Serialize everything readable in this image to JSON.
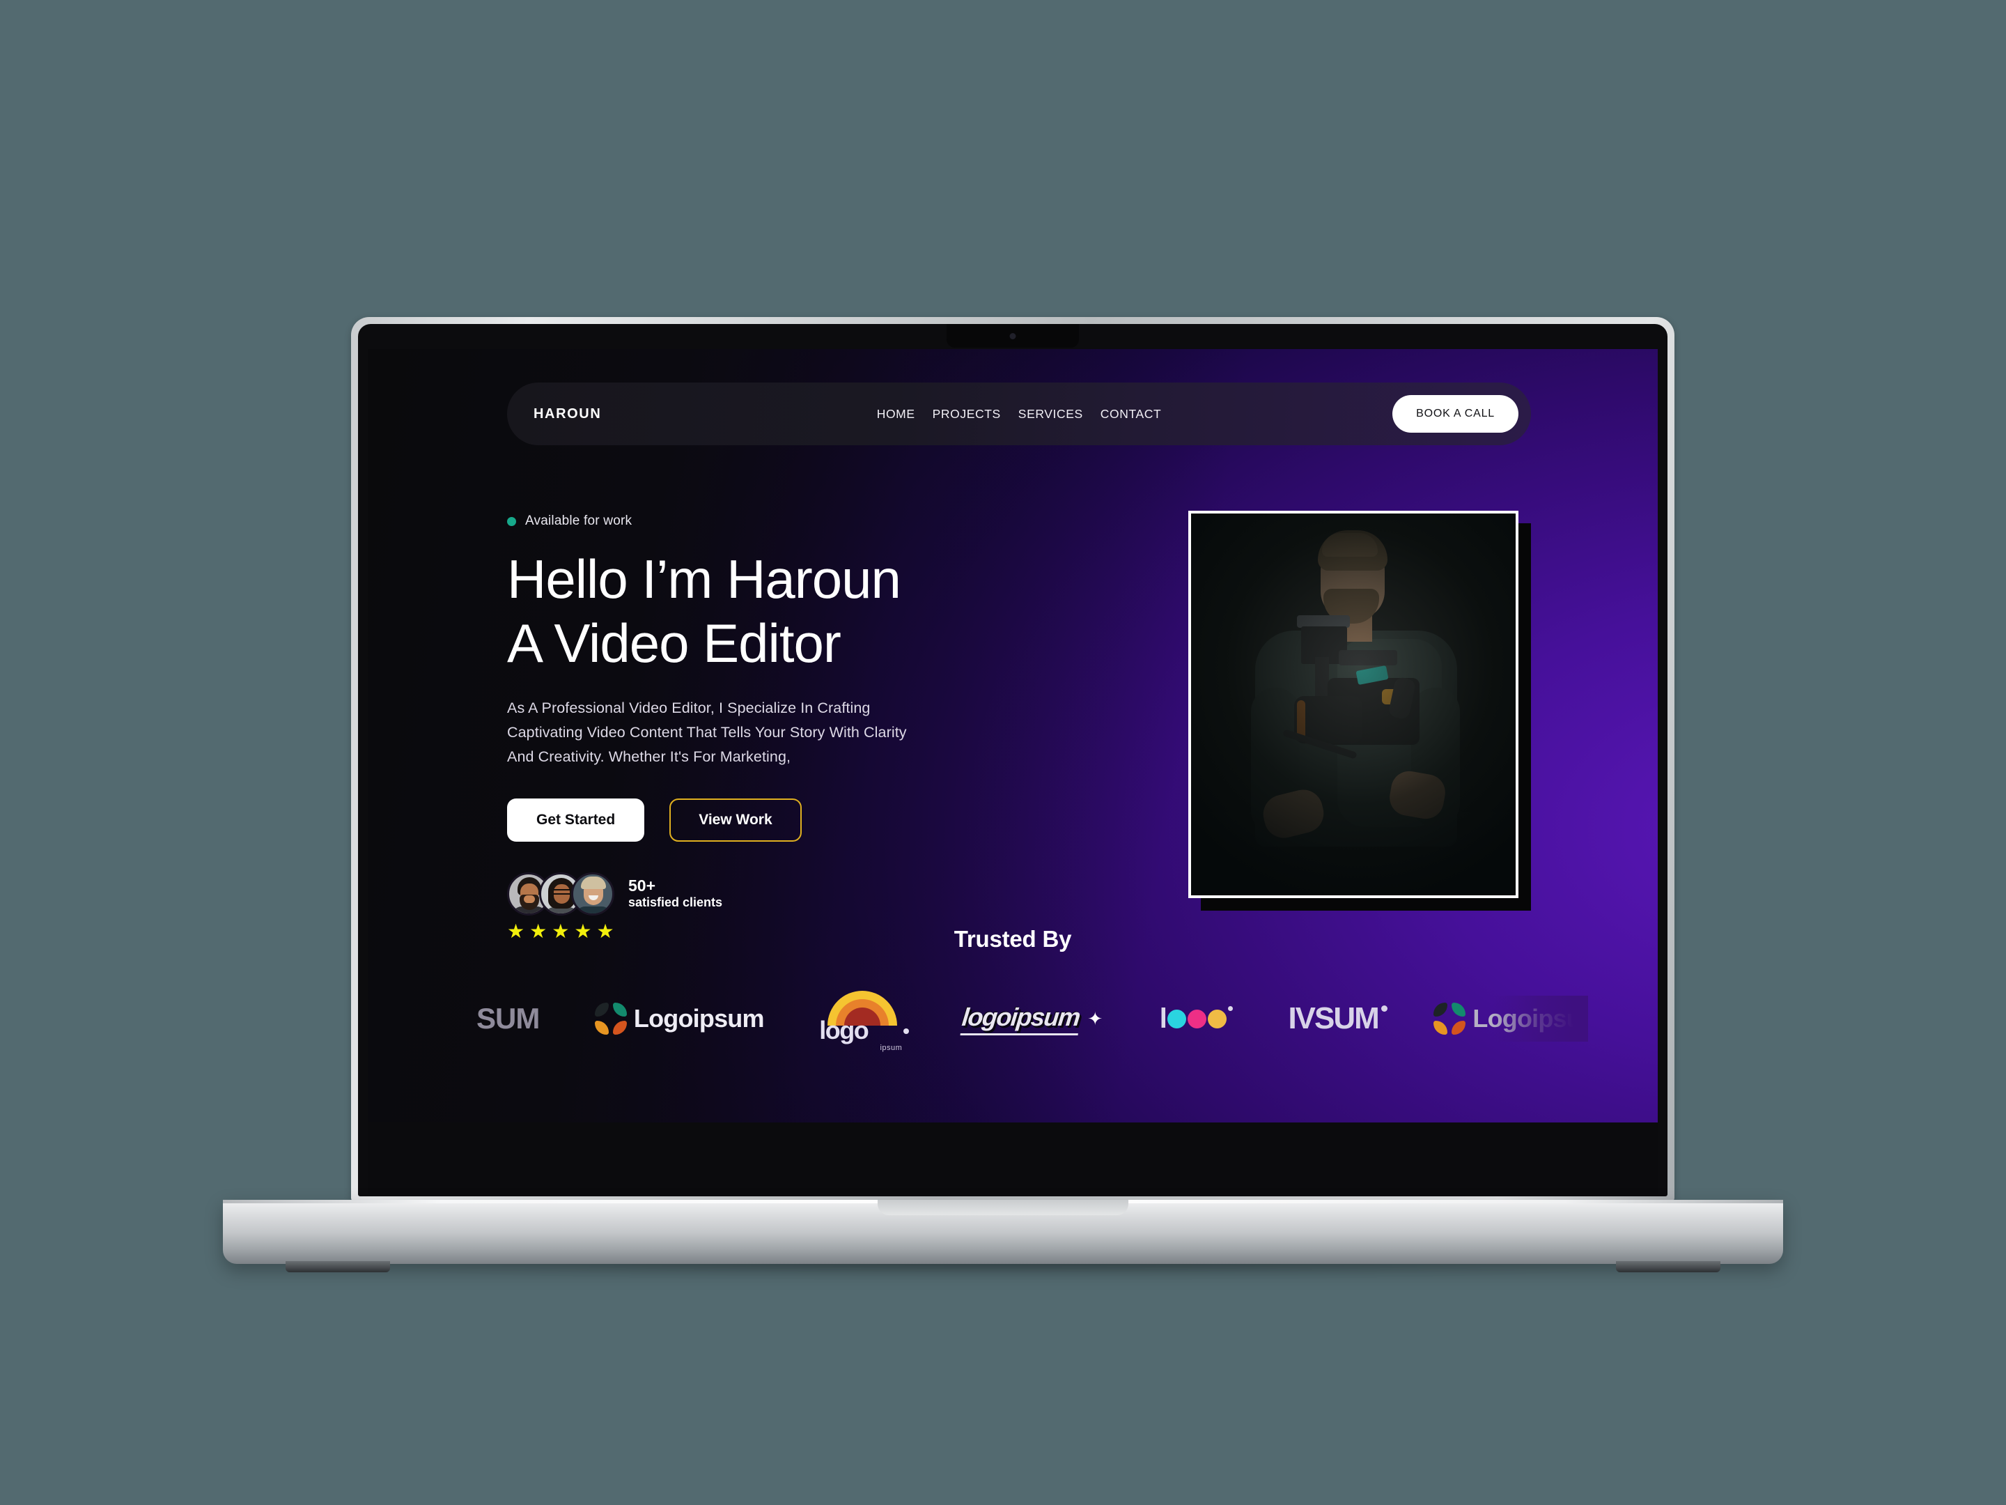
{
  "device": {
    "type": "laptop-mockup",
    "brand_chrome_color": "#c9ccce"
  },
  "site": {
    "nav": {
      "brand": "HAROUN",
      "links": [
        {
          "label": "HOME"
        },
        {
          "label": "PROJECTS"
        },
        {
          "label": "SERVICES"
        },
        {
          "label": "CONTACT"
        }
      ],
      "cta_label": "BOOK A CALL"
    },
    "hero": {
      "availability_badge": "Available for work",
      "availability_dot_color": "#17a98b",
      "title_line1": "Hello I’m Haroun",
      "title_line2": "A Video Editor",
      "description": "As A Professional Video Editor, I Specialize In Crafting Captivating Video Content That Tells Your Story With Clarity And Creativity. Whether It's For Marketing,",
      "primary_button": "Get Started",
      "secondary_button": "View Work",
      "secondary_button_border_color": "#e0b020",
      "social_proof": {
        "count": "50+",
        "caption": "satisfied clients",
        "stars": 5,
        "star_color": "#f2ef0c",
        "avatars": [
          "avatar-man-beard",
          "avatar-woman-glasses",
          "avatar-man-blond"
        ]
      },
      "image_alt": "videographer-holding-camera-rig"
    },
    "trusted": {
      "title": "Trusted By",
      "logos": [
        {
          "name": "ipsum-grey-clipped",
          "text": "SUM",
          "style": "clipped-left"
        },
        {
          "name": "logoipsum-pinwheel",
          "text": "Logoipsum",
          "style": "pinwheel-white"
        },
        {
          "name": "logo-ipsum-rainbow",
          "text": "logo",
          "sub": "ipsum",
          "style": "rainbow-arc"
        },
        {
          "name": "logoipsum-italic-outline",
          "text": "logoipsum",
          "style": "italic-outline"
        },
        {
          "name": "logo-cmyk-dots",
          "text": "logo",
          "style": "cmyk-circles"
        },
        {
          "name": "ivsum-wordmark",
          "text": "IVSUM",
          "style": "light-lavender"
        },
        {
          "name": "logoipsum-pinwheel-faded",
          "text": "Logoipsu",
          "style": "pinwheel-faded"
        }
      ]
    },
    "theme": {
      "background_dark": "#0a0a0c",
      "background_purple": "#4a1194",
      "accent_white": "#ffffff"
    }
  }
}
